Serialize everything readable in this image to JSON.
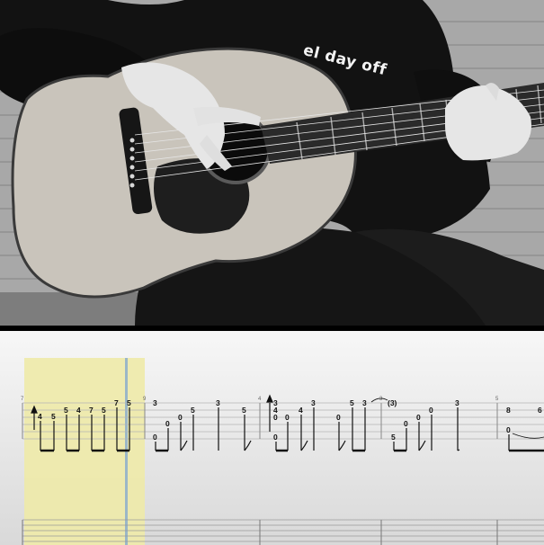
{
  "video": {
    "shirt_text": "el day off"
  },
  "tab": {
    "bar_numbers": [
      "7",
      "9",
      "4",
      "3",
      "5"
    ],
    "notes": [
      {
        "fret": "4"
      },
      {
        "fret": "5"
      },
      {
        "fret": "5"
      },
      {
        "fret": "4"
      },
      {
        "fret": "7"
      },
      {
        "fret": "5"
      },
      {
        "fret": "7"
      },
      {
        "fret": "5"
      },
      {
        "fret": "0"
      },
      {
        "fret": "3"
      },
      {
        "fret": "0"
      },
      {
        "fret": "0"
      },
      {
        "fret": "5"
      },
      {
        "fret": "3"
      },
      {
        "fret": "5"
      },
      {
        "fret": "3"
      },
      {
        "fret": "4"
      },
      {
        "fret": "0"
      },
      {
        "fret": "0"
      },
      {
        "fret": "4"
      },
      {
        "fret": "0"
      },
      {
        "fret": "3"
      },
      {
        "fret": "0"
      },
      {
        "fret": "5"
      },
      {
        "fret": "3"
      },
      {
        "fret": "(3)"
      },
      {
        "fret": "0"
      },
      {
        "fret": "5"
      },
      {
        "fret": "0"
      },
      {
        "fret": "3"
      },
      {
        "fret": "0"
      },
      {
        "fret": "8"
      },
      {
        "fret": "0"
      },
      {
        "fret": "6"
      }
    ]
  }
}
